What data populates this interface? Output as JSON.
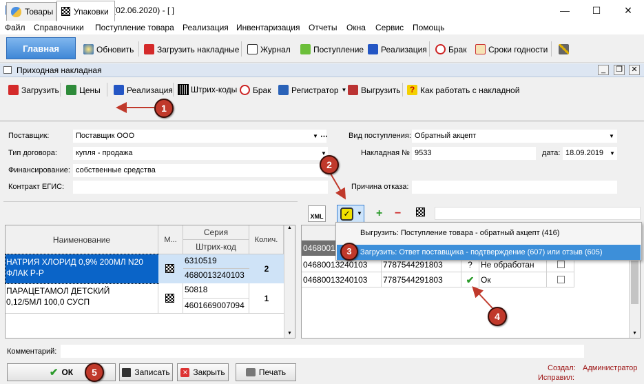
{
  "window": {
    "title": "Фарм-ревизор. 2.0.4.96 (02.06.2020) - [ ]",
    "app_icon": "Фр"
  },
  "menu": [
    "Файл",
    "Справочники",
    "Поступление товара",
    "Реализация",
    "Инвентаризация",
    "Отчеты",
    "Окна",
    "Сервис",
    "Помощь"
  ],
  "toolbar": {
    "main_tab": "Главная",
    "refresh": "Обновить",
    "load_invoices": "Загрузить накладные",
    "journal": "Журнал",
    "receipt": "Поступление",
    "sales": "Реализация",
    "defect": "Брак",
    "expiry": "Сроки годности"
  },
  "doc": {
    "title": "Приходная накладная"
  },
  "doc_toolbar": {
    "load": "Загрузить",
    "prices": "Цены",
    "sales": "Реализация",
    "barcodes": "Штрих-коды",
    "defect": "Брак",
    "registrar": "Регистратор",
    "export": "Выгрузить",
    "help": "Как работать с накладной"
  },
  "tabs": {
    "goods": "Товары",
    "packages": "Упаковки"
  },
  "form": {
    "supplier_label": "Поставщик:",
    "supplier_value": "Поставщик ООО",
    "contract_label": "Тип договора:",
    "contract_value": "купля - продажа",
    "finance_label": "Финансирование:",
    "finance_value": "собственные средства",
    "egis_label": "Контракт ЕГИС:",
    "egis_value": "",
    "receipt_type_label": "Вид поступления:",
    "receipt_type_value": "Обратный акцепт",
    "invoice_label": "Накладная №",
    "invoice_value": "9533",
    "date_label": "дата:",
    "date_value": "18.09.2019",
    "refusal_label": "Причина отказа:",
    "refusal_value": ""
  },
  "left_table": {
    "headers": {
      "name": "Наименование",
      "mark": "М...",
      "series": "Серия",
      "barcode": "Штрих-код",
      "qty": "Колич."
    },
    "rows": [
      {
        "name_line1": "НАТРИЯ ХЛОРИД 0,9% 200МЛ N20",
        "name_line2": "ФЛАК Р-Р",
        "series": "6310519",
        "barcode": "4680013240103",
        "qty": "2"
      },
      {
        "name_line1": "ПАРАЦЕТАМОЛ ДЕТСКИЙ",
        "name_line2": "0,12/5МЛ 100,0 СУСП",
        "series": "50818",
        "barcode": "4601669007094",
        "qty": "1"
      }
    ]
  },
  "right_toolbar": {
    "xml": "XML"
  },
  "popup": {
    "item1": "Выгрузить: Поступление товара - обратный акцепт (416)",
    "item2": "Загрузить: Ответ поставщика - подтверждение (607) или отзыв (605)"
  },
  "right_table": {
    "partial_header": "G",
    "rows": [
      {
        "gtin": "0468001",
        "serial": "",
        "mark": "",
        "status": ""
      },
      {
        "gtin": "04680013240103",
        "serial": "7787544291803",
        "mark": "?",
        "status": "Не обработан"
      },
      {
        "gtin": "04680013240103",
        "serial": "7787544291803",
        "mark": "✔",
        "status": "Ок"
      }
    ]
  },
  "comment_label": "Комментарий:",
  "buttons": {
    "ok": "ОК",
    "save": "Записать",
    "close": "Закрыть",
    "print": "Печать"
  },
  "footer": {
    "created_label": "Создал:",
    "created_value": "Администратор",
    "edited_label": "Исправил:"
  },
  "annotations": [
    "1",
    "2",
    "3",
    "4",
    "5"
  ],
  "colors": {
    "accent": "#3d8fd9",
    "selection": "#0a64c8",
    "badge": "#c0392b",
    "check": "#2a9a2a"
  }
}
